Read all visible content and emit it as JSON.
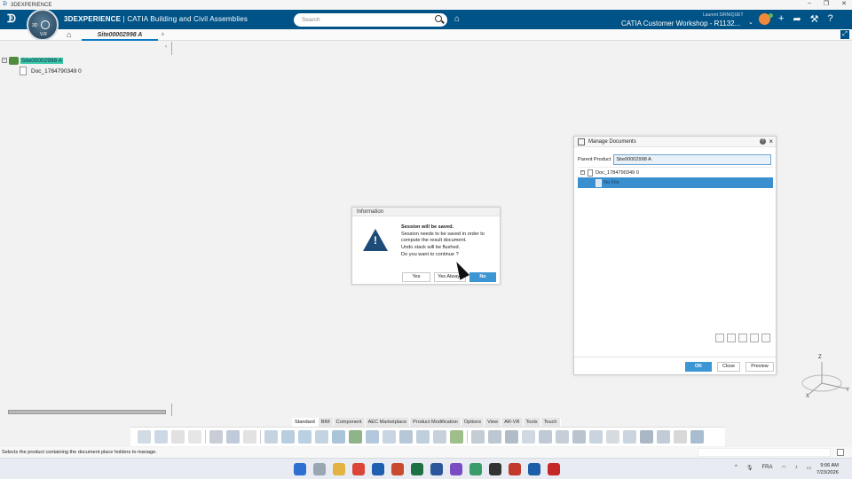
{
  "window": {
    "title": "3DEXPERIENCE"
  },
  "header": {
    "ds_logo": "𝔇𝔖",
    "brand_bold": "3DEXPERIENCE",
    "brand_rest": " | CATIA Building and Civil Assemblies",
    "search_placeholder": "Search",
    "user": "Laurent SIRNIQUET",
    "workspace": "CATIA Customer Workshop - R1132...",
    "compass_version": "V.R",
    "compass_3d": "3D"
  },
  "tabs": {
    "active": "Site00002998 A"
  },
  "tree": {
    "root": "Site00002998 A",
    "child": "Doc_1784790349 0"
  },
  "info_dialog": {
    "title": "Information",
    "heading": "Session will be saved.",
    "lines": [
      "Session needs to be saved in order to",
      "compute the result document.",
      "Undo stack will be flushed.",
      "Do you want to continue ?"
    ],
    "buttons": {
      "yes": "Yes",
      "yes_always": "Yes Always",
      "no": "No"
    }
  },
  "manage_dialog": {
    "title": "Manage Documents",
    "parent_label": "Parent Product",
    "parent_value": "Site00002998 A",
    "doc": "Doc_1784790349 0",
    "selected": "No File",
    "buttons": {
      "ok": "OK",
      "close": "Close",
      "preview": "Preview"
    }
  },
  "axes": {
    "z": "Z",
    "x": "X",
    "y": "Y"
  },
  "section_tabs": [
    "Standard",
    "BIM",
    "Component",
    "AEC Marketplace",
    "Product Modification",
    "Options",
    "View",
    "AR-VR",
    "Tools",
    "Touch"
  ],
  "status_text": "Selects the product containing the document place holders to manage.",
  "taskbar": {
    "lang": "FRA",
    "time": "9:06 AM",
    "date": "7/23/2026"
  },
  "colors": {
    "header_bg": "#005386",
    "accent": "#3c96d4",
    "selection": "#3a8fcf",
    "tree_highlight": "#39c6a5"
  }
}
